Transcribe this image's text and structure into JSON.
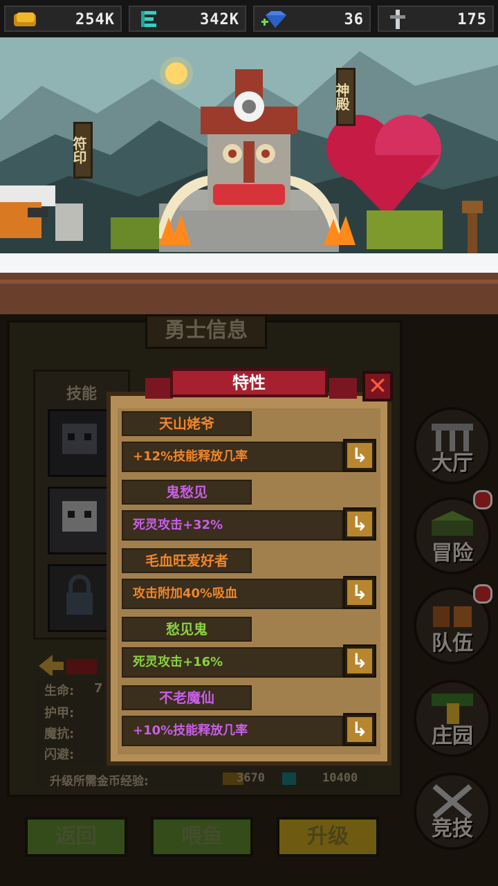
{
  "currency": {
    "gold": "254K",
    "energy": "342K",
    "gem": "36",
    "sword": "175"
  },
  "scene": {
    "sign_left": "符印",
    "sign_right": "神殿"
  },
  "hero_panel": {
    "title": "勇士信息",
    "skills_tab": "技能",
    "stats": [
      "生命:",
      "护甲:",
      "魔抗:",
      "闪避:"
    ],
    "hp_value": "7",
    "upgrade_label": "升级所需金币经验:",
    "upgrade_gold": "3670",
    "upgrade_exp": "10400"
  },
  "nav": [
    {
      "label": "大厅",
      "badge": false
    },
    {
      "label": "冒险",
      "badge": true
    },
    {
      "label": "队伍",
      "badge": true
    },
    {
      "label": "庄园",
      "badge": false
    },
    {
      "label": "竞技",
      "badge": false
    }
  ],
  "bottom_buttons": {
    "back": "返回",
    "feed": "喂鱼",
    "upgrade": "升级"
  },
  "dialog": {
    "title": "特性",
    "close_glyph": "✕",
    "traits": [
      {
        "name": "天山姥爷",
        "name_color": "#f0862a",
        "desc": "+12%技能释放几率",
        "desc_color": "#f0862a"
      },
      {
        "name": "鬼愁见",
        "name_color": "#c85ee8",
        "desc": "死灵攻击+32%",
        "desc_color": "#c85ee8"
      },
      {
        "name": "毛血旺爱好者",
        "name_color": "#f0862a",
        "desc": "攻击附加40%吸血",
        "desc_color": "#f0862a"
      },
      {
        "name": "愁见鬼",
        "name_color": "#8ad043",
        "desc": "死灵攻击+16%",
        "desc_color": "#8ad043"
      },
      {
        "name": "不老魔仙",
        "name_color": "#c85ee8",
        "desc": "+10%技能释放几率",
        "desc_color": "#c85ee8"
      }
    ],
    "action_glyph": "↳"
  }
}
